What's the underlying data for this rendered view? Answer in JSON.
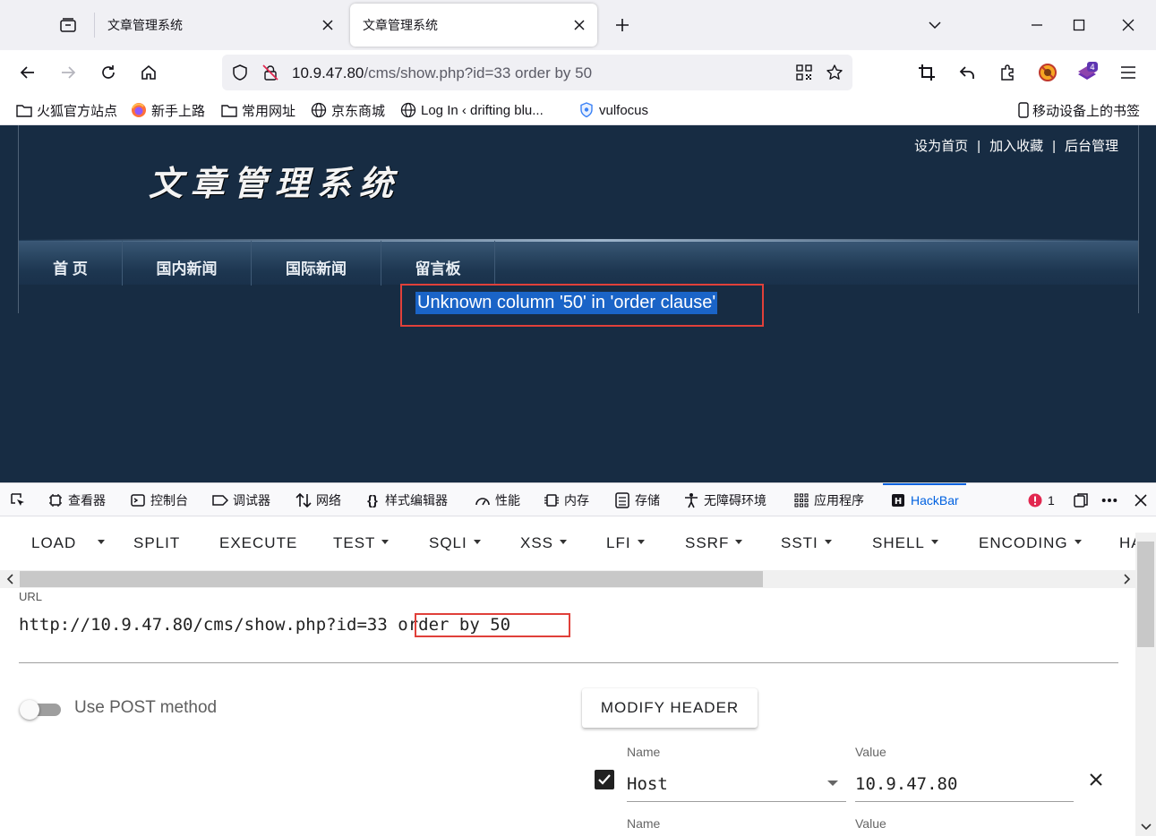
{
  "tabs": [
    {
      "title": "文章管理系统"
    },
    {
      "title": "文章管理系统"
    }
  ],
  "navbar": {
    "url_host": "10.9.47.80",
    "url_path": "/cms/show.php?id=33 order by 50",
    "extension_badge": "4"
  },
  "bookmarks": [
    {
      "label": "火狐官方站点",
      "icon": "folder-icon"
    },
    {
      "label": "新手上路",
      "icon": "firefox-icon"
    },
    {
      "label": "常用网址",
      "icon": "folder-icon"
    },
    {
      "label": "京东商城",
      "icon": "globe-icon"
    },
    {
      "label": "Log In ‹ drifting blu...",
      "icon": "globe-icon"
    },
    {
      "label": "vulfocus",
      "icon": "shield-icon"
    }
  ],
  "mobile_bookmarks": "移动设备上的书签",
  "site": {
    "title": "文章管理系统",
    "top_links": [
      "设为首页",
      "加入收藏",
      "后台管理"
    ],
    "top_links_sep": "|",
    "nav": [
      "首 页",
      "国内新闻",
      "国际新闻",
      "留言板"
    ],
    "error": "Unknown column '50' in 'order clause'"
  },
  "devtools": {
    "tabs": [
      "查看器",
      "控制台",
      "调试器",
      "网络",
      "样式编辑器",
      "性能",
      "内存",
      "存储",
      "无障碍环境",
      "应用程序",
      "HackBar"
    ],
    "error_count": "1",
    "colors": {
      "active": "#0061e0",
      "error": "#e22850"
    }
  },
  "hackbar": {
    "menu": [
      {
        "label": "LOAD",
        "caret": false
      },
      {
        "label": "SPLIT",
        "caret": false
      },
      {
        "label": "EXECUTE",
        "caret": false
      },
      {
        "label": "TEST",
        "caret": true
      },
      {
        "label": "SQLI",
        "caret": true
      },
      {
        "label": "XSS",
        "caret": true
      },
      {
        "label": "LFI",
        "caret": true
      },
      {
        "label": "SSRF",
        "caret": true
      },
      {
        "label": "SSTI",
        "caret": true
      },
      {
        "label": "SHELL",
        "caret": true
      },
      {
        "label": "ENCODING",
        "caret": true
      },
      {
        "label": "HA",
        "caret": false
      }
    ],
    "url_label": "URL",
    "url_base": "http://10.9.47.80/cms/show.php?id=33",
    "url_suffix": " order by 50",
    "post_label": "Use POST method",
    "modify_header": "MODIFY HEADER",
    "header": {
      "name_label": "Name",
      "value_label": "Value",
      "name": "Host",
      "value": "10.9.47.80",
      "next_name_label": "Name",
      "next_value_label": "Value"
    }
  }
}
